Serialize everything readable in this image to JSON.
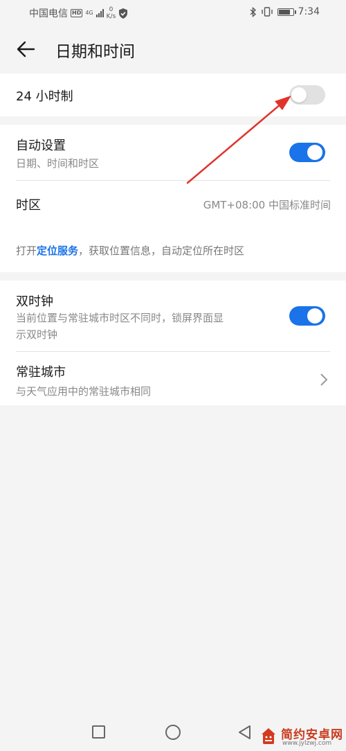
{
  "status_bar": {
    "carrier": "中国电信",
    "hd_badge": "HD",
    "network_type": "4G",
    "speed_value": "0",
    "speed_unit": "K/s",
    "time": "7:34",
    "battery_level_percent": 85
  },
  "header": {
    "title": "日期和时间",
    "back_icon": "back-arrow-icon"
  },
  "hour24": {
    "label": "24 小时制",
    "enabled": false
  },
  "auto_setting": {
    "title": "自动设置",
    "subtitle": "日期、时间和时区",
    "enabled": true
  },
  "timezone": {
    "label": "时区",
    "value": "GMT+08:00 中国标准时间"
  },
  "location_hint": {
    "prefix": "打开",
    "link": "定位服务",
    "suffix": "，获取位置信息，自动定位所在时区"
  },
  "dual_clock": {
    "title": "双时钟",
    "subtitle_line1": "当前位置与常驻城市时区不同时，锁屏界面显",
    "subtitle_line2": "示双时钟",
    "enabled": true
  },
  "home_city": {
    "title": "常驻城市",
    "subtitle": "与天气应用中的常驻城市相同"
  },
  "watermark": {
    "text": "简约安卓网",
    "url": "www.jylzwj.com"
  },
  "colors": {
    "accent": "#1a73e8",
    "annotation_arrow": "#e0342a",
    "page_background": "#f4f4f4"
  }
}
